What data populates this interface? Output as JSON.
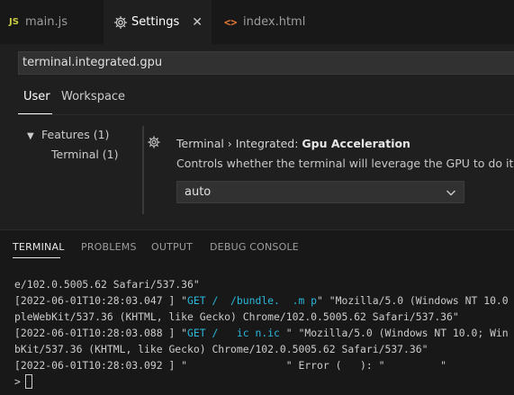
{
  "tabs": {
    "main": {
      "icon": "javascript-file-icon",
      "icon_text": "JS",
      "label": "main.js"
    },
    "settings": {
      "icon": "settings-gear-icon",
      "label": "Settings",
      "close": "✕"
    },
    "index": {
      "icon": "html-file-icon",
      "icon_text": "<>",
      "label": "index.html"
    }
  },
  "settings_editor": {
    "search_value": "terminal.integrated.gpu",
    "scope_tabs": [
      "User",
      "Workspace"
    ],
    "toc": {
      "features": "Features (1)",
      "terminal": "Terminal (1)"
    },
    "setting": {
      "category": "Terminal › Integrated: ",
      "name": "Gpu Acceleration",
      "description": "Controls whether the terminal will leverage the GPU to do its rendering.",
      "value": "auto"
    }
  },
  "panel": {
    "tabs": [
      "TERMINAL",
      "PROBLEMS",
      "OUTPUT",
      "DEBUG CONSOLE"
    ],
    "terminal_lines": [
      "e/102.0.5005.62 Safari/537.36\"",
      "[2022-06-01T10:28:03.047 ] \"GET /  /bundle.  .m p\" \"Mozilla/5.0 (Windows NT 10.0",
      "pleWebKit/537.36 (KHTML, like Gecko) Chrome/102.0.5005.62 Safari/537.36\"",
      "[2022-06-01T10:28:03.088 ] \"GET /   ic n.ic \" \"Mozilla/5.0 (Windows NT 10.0; Win",
      "bKit/537.36 (KHTML, like Gecko) Chrome/102.0.5005.62 Safari/537.36\"",
      "[2022-06-01T10:28:03.092 ] \"                \" Error (   ): \"         \""
    ],
    "line1_parts": {
      "prefix": "[2022-06-01T10:28:03.047 ] \"",
      "request": "GET /  /bundle.  .m p",
      "suffix": "\" \"Mozilla/5.0 (Windows NT 10.0"
    },
    "line3_parts": {
      "prefix": "[2022-06-01T10:28:03.088 ] \"",
      "request": "GET /   ic n.ic ",
      "suffix": "\" \"Mozilla/5.0 (Windows NT 10.0; Win"
    },
    "prompt": ">"
  },
  "colors": {
    "request_highlight": "#29b8db",
    "js_icon": "#cbcb41",
    "html_icon": "#e37933"
  }
}
